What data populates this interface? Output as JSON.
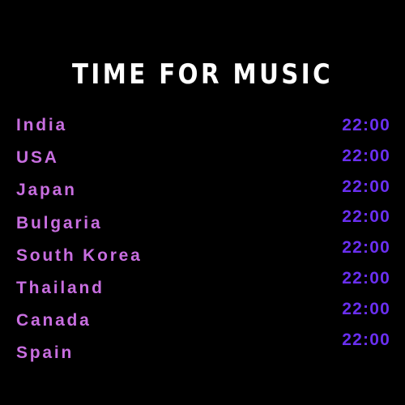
{
  "title": "TIME FOR MUSIC",
  "colors": {
    "background": "#000000",
    "title": "#ffffff",
    "country": "#c86ee0",
    "time": "#6a2ff0"
  },
  "schedule": [
    {
      "country": "India",
      "time": "22:00"
    },
    {
      "country": "USA",
      "time": "22:00"
    },
    {
      "country": "Japan",
      "time": "22:00"
    },
    {
      "country": "Bulgaria",
      "time": "22:00"
    },
    {
      "country": "South Korea",
      "time": "22:00"
    },
    {
      "country": "Thailand",
      "time": "22:00"
    },
    {
      "country": "Canada",
      "time": "22:00"
    },
    {
      "country": "Spain",
      "time": "22:00"
    }
  ]
}
